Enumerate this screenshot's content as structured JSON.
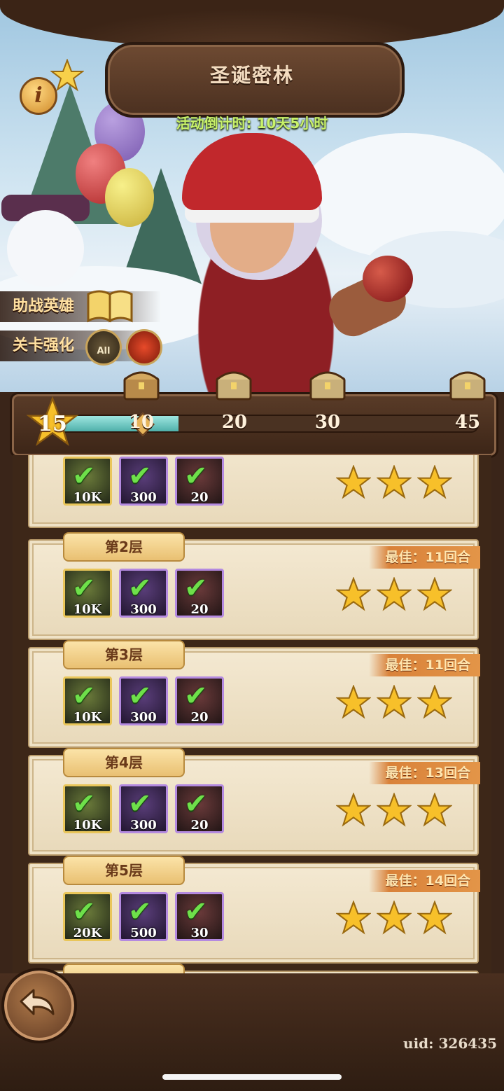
{
  "header": {
    "title": "圣诞密林",
    "countdown": "活动倒计时: 10天5小时",
    "info_icon": "i"
  },
  "side_buttons": {
    "support_hero": "助战英雄",
    "stage_boost": "关卡强化",
    "crown_badge": "All"
  },
  "progress": {
    "current_stars": "15",
    "milestones": [
      "10",
      "20",
      "30",
      "45"
    ],
    "fill_fraction": 0.3
  },
  "floors": [
    {
      "label": "",
      "best": "",
      "rewards": [
        "10K",
        "300",
        "20"
      ],
      "stars": 3
    },
    {
      "label": "第2层",
      "best": "最佳：11回合",
      "rewards": [
        "10K",
        "300",
        "20"
      ],
      "stars": 3
    },
    {
      "label": "第3层",
      "best": "最佳：11回合",
      "rewards": [
        "10K",
        "300",
        "20"
      ],
      "stars": 3
    },
    {
      "label": "第4层",
      "best": "最佳：13回合",
      "rewards": [
        "10K",
        "300",
        "20"
      ],
      "stars": 3
    },
    {
      "label": "第5层",
      "best": "最佳：14回合",
      "rewards": [
        "20K",
        "500",
        "30"
      ],
      "stars": 3
    }
  ],
  "footer": {
    "uid": "uid: 326435",
    "back_icon": "back-arrow-icon"
  },
  "colors": {
    "countdown": "#c9f26a",
    "check": "#6ee04a",
    "star": "#f7c02a"
  }
}
